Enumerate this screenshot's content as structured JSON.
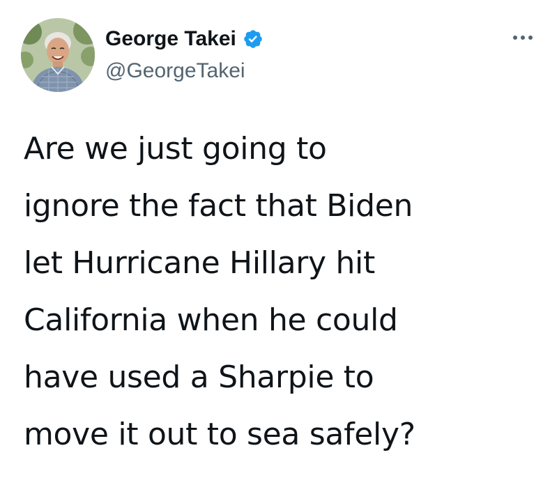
{
  "author": {
    "display_name": "George Takei",
    "handle": "@GeorgeTakei",
    "verified": true,
    "avatar_icon": "profile-photo",
    "verified_icon": "verified-badge-icon"
  },
  "menu": {
    "more_icon": "more-options-icon"
  },
  "tweet": {
    "lines": [
      "Are we just going to",
      "ignore the fact that Biden",
      "let Hurricane Hillary hit",
      "California when he could",
      "have used a Sharpie to",
      "move it out to sea safely?"
    ]
  },
  "colors": {
    "text": "#0f1419",
    "secondary_text": "#536471",
    "verified_badge": "#1d9bf0",
    "background": "#ffffff"
  }
}
